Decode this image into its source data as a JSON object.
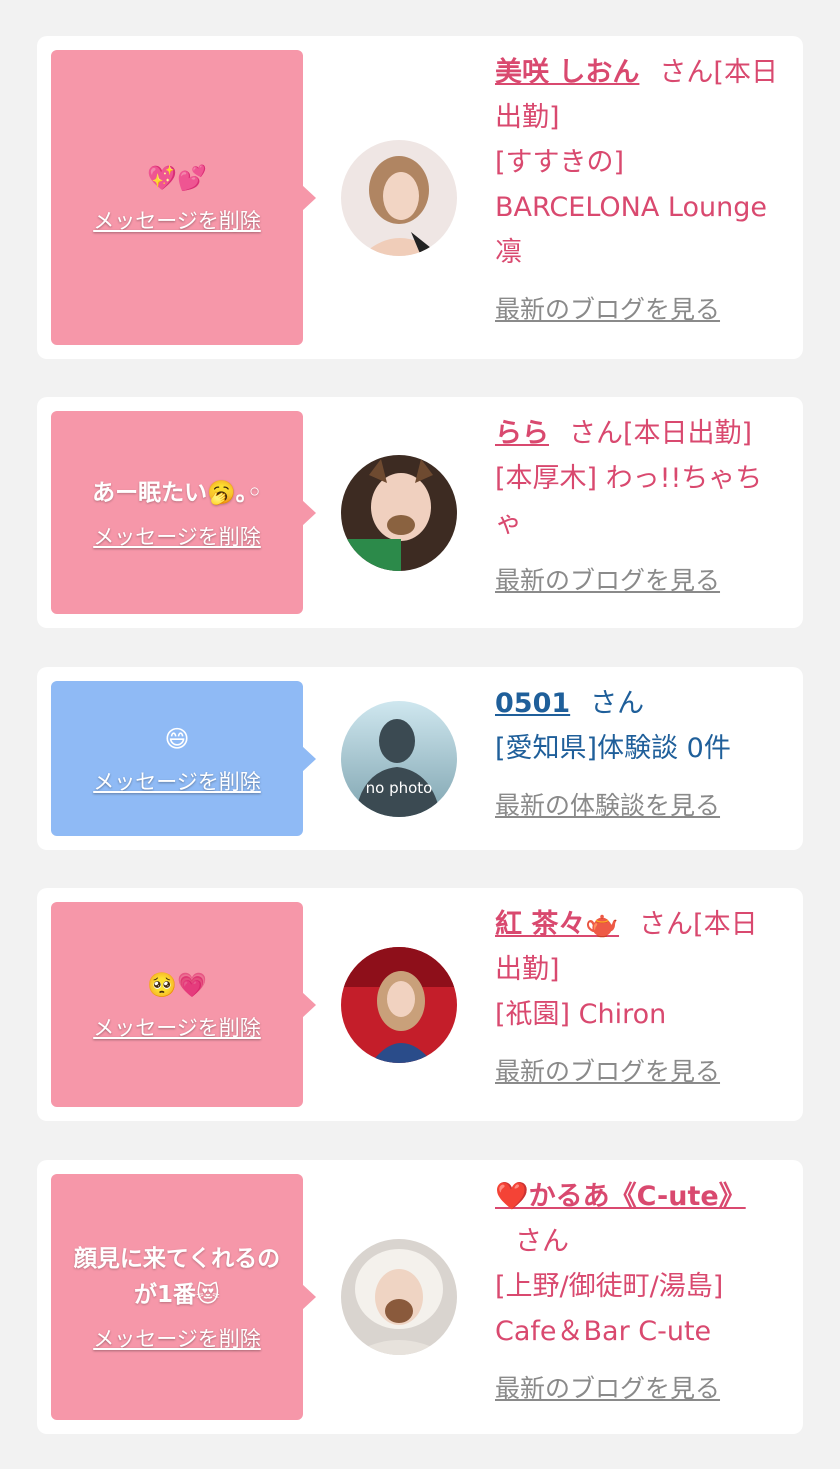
{
  "delete_label": "メッセージを削除",
  "colors": {
    "pink_bubble": "#f697a9",
    "blue_bubble": "#8fbaf5",
    "pink_text": "#d9496f",
    "blue_text": "#1f5f9a"
  },
  "cards": [
    {
      "message": "💖💕",
      "name": "美咲 しおん",
      "san": "さん[本日出勤]",
      "shop": "[すすきの] BARCELONA Lounge 凛",
      "link": "最新のブログを見る"
    },
    {
      "message": "あー眠たい🥱｡◦",
      "name": "らら",
      "san": "さん[本日出勤]",
      "shop": "[本厚木] わっ!!ちゃちゃ",
      "link": "最新のブログを見る"
    },
    {
      "message": "😄",
      "name": "0501",
      "san": "さん",
      "shop": "[愛知県]体験談 0件",
      "avatar_text": "no photo",
      "link": "最新の体験談を見る"
    },
    {
      "message": "🥺💗",
      "name": "紅 茶々🫖",
      "san": "さん[本日出勤]",
      "shop": "[祇園] Chiron",
      "link": "最新のブログを見る"
    },
    {
      "message": "顔見に来てくれるのが1番😻",
      "name": "❤️かるあ《C-ute》",
      "san": "さん",
      "shop": "[上野/御徒町/湯島] Cafe＆Bar C-ute",
      "link": "最新のブログを見る"
    }
  ]
}
